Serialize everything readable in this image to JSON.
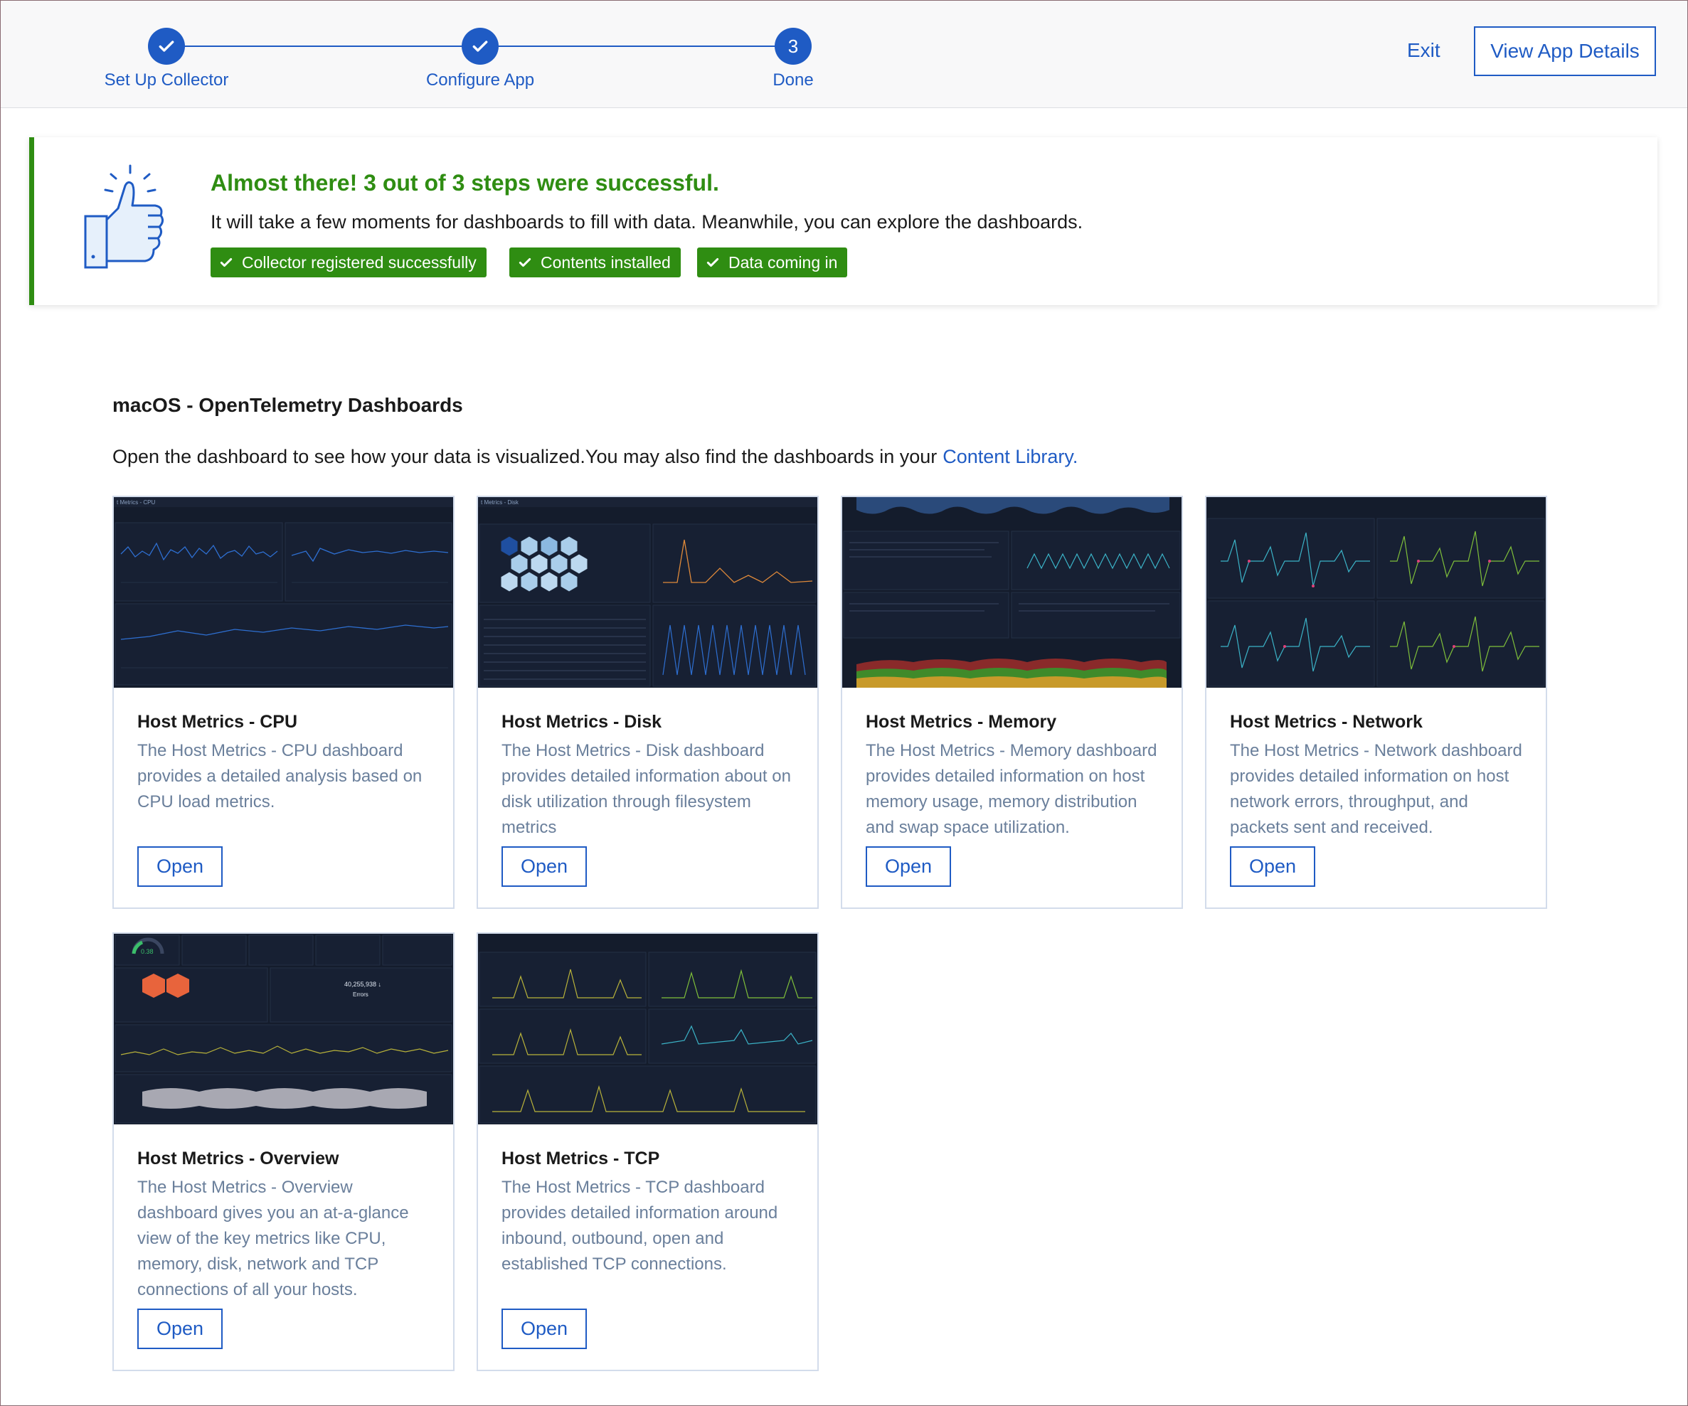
{
  "stepper": {
    "steps": [
      {
        "label": "Set Up Collector",
        "state": "complete"
      },
      {
        "label": "Configure App",
        "state": "complete"
      },
      {
        "label": "Done",
        "state": "current",
        "number": "3"
      }
    ]
  },
  "header": {
    "exit_label": "Exit",
    "view_details_label": "View App Details"
  },
  "banner": {
    "title": "Almost there! 3 out of 3 steps were successful.",
    "text": "It will take a few moments for dashboards to fill with data. Meanwhile, you can explore the dashboards.",
    "chips": [
      "Collector registered successfully",
      "Contents installed",
      "Data coming in"
    ]
  },
  "section": {
    "title": "macOS - OpenTelemetry Dashboards",
    "description": "Open the dashboard to see how your data is visualized.You may also find the dashboards in your",
    "link_label": "Content Library."
  },
  "cards": [
    {
      "title": "Host Metrics - CPU",
      "description": "The Host Metrics - CPU dashboard provides a detailed analysis based on CPU load metrics.",
      "button": "Open"
    },
    {
      "title": "Host Metrics - Disk",
      "description": "The Host Metrics - Disk dashboard provides detailed information about on disk utilization through filesystem metrics",
      "button": "Open"
    },
    {
      "title": "Host Metrics - Memory",
      "description": "The Host Metrics - Memory dashboard provides detailed information on host memory usage, memory distribution and swap space utilization.",
      "button": "Open"
    },
    {
      "title": "Host Metrics - Network",
      "description": "The Host Metrics - Network dashboard provides detailed information on host network errors, throughput, and packets sent and received.",
      "button": "Open"
    },
    {
      "title": "Host Metrics - Overview",
      "description": "The Host Metrics - Overview dashboard gives you an at-a-glance view of the key metrics like CPU, memory, disk, network and TCP connections of all your hosts.",
      "button": "Open"
    },
    {
      "title": "Host Metrics - TCP",
      "description": "The Host Metrics - TCP dashboard provides detailed information around inbound, outbound, open and established TCP connections.",
      "button": "Open"
    }
  ],
  "thumbnails": {
    "cpu": {
      "title": "t Metrics - CPU"
    },
    "disk": {
      "title": "t Metrics - Disk"
    },
    "overview": {
      "gauge_value": "0.38",
      "errors_value": "40,255,938 ↓",
      "errors_label": "Errors"
    }
  },
  "colors": {
    "primary": "#1f5bc4",
    "success": "#2f8d12",
    "muted_text": "#6a7f9b",
    "thumb_bg": "#141c2c"
  }
}
